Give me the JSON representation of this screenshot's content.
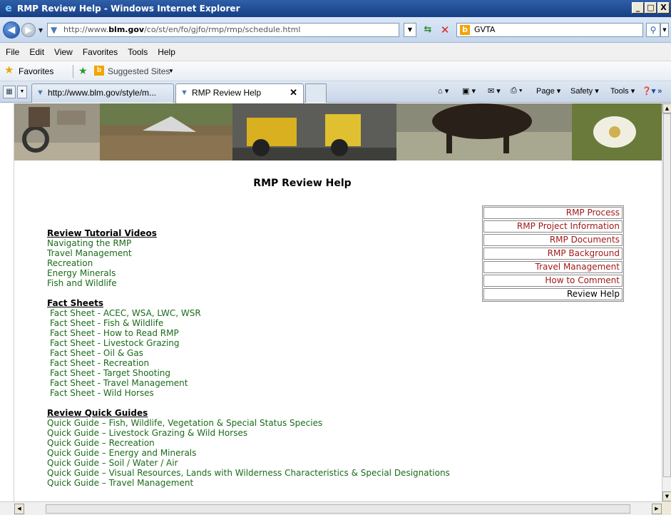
{
  "window": {
    "title": "RMP Review Help - Windows Internet Explorer",
    "min": "_",
    "max": "□",
    "close": "X"
  },
  "address": {
    "prefix": "http://www.",
    "domain": "blm.gov",
    "path": "/co/st/en/fo/gjfo/rmp/rmp/schedule.html"
  },
  "search": {
    "value": "GVTA"
  },
  "menu": [
    "File",
    "Edit",
    "View",
    "Favorites",
    "Tools",
    "Help"
  ],
  "favorites": {
    "label": "Favorites",
    "suggested": "Suggested Sites"
  },
  "tabs": [
    {
      "label": "http://www.blm.gov/style/m..."
    },
    {
      "label": "RMP Review Help"
    }
  ],
  "commands": {
    "page": "Page",
    "safety": "Safety",
    "tools": "Tools"
  },
  "page": {
    "heading": "RMP Review Help",
    "sidenav": [
      "RMP Process",
      "RMP Project Information",
      "RMP Documents",
      "RMP Background",
      "Travel Management",
      "How to Comment",
      "Review Help"
    ],
    "tutorials": {
      "title": "Review Tutorial Videos",
      "items": [
        "Navigating the RMP",
        "Travel Management",
        "Recreation",
        "Energy Minerals",
        "Fish and Wildlife"
      ]
    },
    "factsheets": {
      "title": "Fact Sheets",
      "items": [
        "Fact Sheet - ACEC, WSA, LWC, WSR",
        "Fact Sheet - Fish & Wildlife",
        "Fact Sheet - How to Read RMP",
        "Fact Sheet - Livestock Grazing",
        "Fact Sheet - Oil & Gas",
        "Fact Sheet - Recreation",
        "Fact Sheet - Target Shooting",
        "Fact Sheet - Travel Management",
        "Fact Sheet - Wild Horses"
      ]
    },
    "quickguides": {
      "title": "Review Quick Guides",
      "items": [
        "Quick Guide – Fish, Wildlife, Vegetation & Special Status Species",
        "Quick Guide – Livestock Grazing & Wild Horses",
        "Quick Guide – Recreation",
        "Quick Guide – Energy and Minerals",
        "Quick Guide – Soil / Water / Air",
        "Quick Guide – Visual Resources, Lands with Wilderness Characteristics & Special Designations",
        "Quick Guide – Travel Management"
      ]
    }
  },
  "colors": {
    "link": "#1a6b1a",
    "navLink": "#a11a1a",
    "titlebar": "#2f5fa8"
  }
}
